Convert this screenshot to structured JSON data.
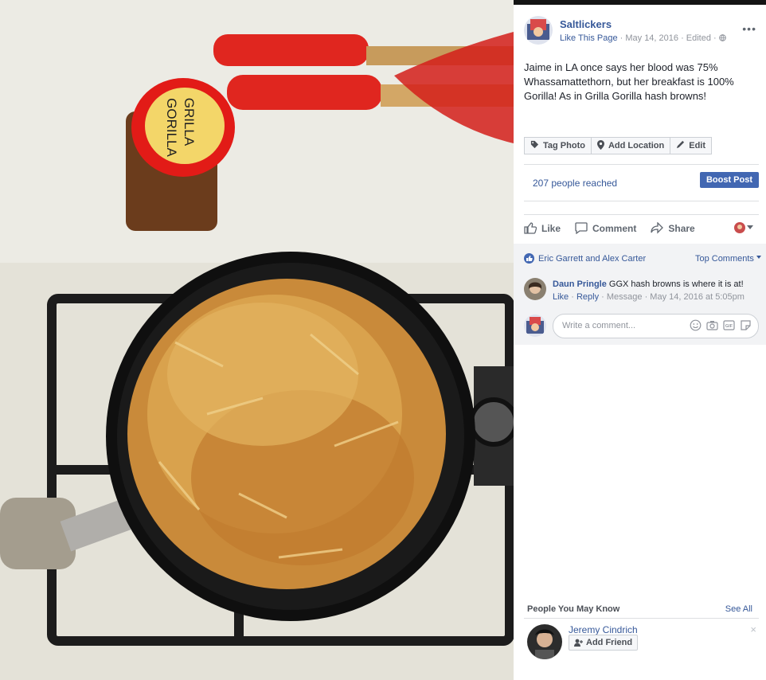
{
  "photo": {
    "spice_label_line1": "GRILLA",
    "spice_label_line2": "GORILLA"
  },
  "post": {
    "page_name": "Saltlickers",
    "like_page_label": "Like This Page",
    "meta": " · May 14, 2016 · Edited · ",
    "more_menu": "•••",
    "caption": "Jaime in LA once says her blood was 75% Whassamattethorn, but her breakfast is 100% Gorilla! As in Grilla Gorilla hash browns!"
  },
  "photo_actions": {
    "tag_photo": "Tag Photo",
    "add_location": "Add Location",
    "edit": "Edit"
  },
  "insights": {
    "reached": "207 people reached",
    "boost_label": "Boost Post"
  },
  "reactions": {
    "like": "Like",
    "comment": "Comment",
    "share": "Share"
  },
  "comments": {
    "liked_by": "Eric Garrett and Alex Carter",
    "sort_label": "Top Comments",
    "items": [
      {
        "author": "Daun Pringle",
        "text": "GGX hash browns is where it is at!",
        "like": "Like",
        "reply": "Reply",
        "meta": " · Message · May 14, 2016 at 5:05pm"
      }
    ],
    "write_placeholder": "Write a comment..."
  },
  "pymk": {
    "title": "People You May Know",
    "see_all": "See All",
    "person_name": "Jeremy Cindrich",
    "add_friend": "Add Friend",
    "dismiss": "×"
  },
  "colors": {
    "link": "#365899",
    "boost": "#4267b2",
    "comment_bg": "#f2f3f5"
  }
}
